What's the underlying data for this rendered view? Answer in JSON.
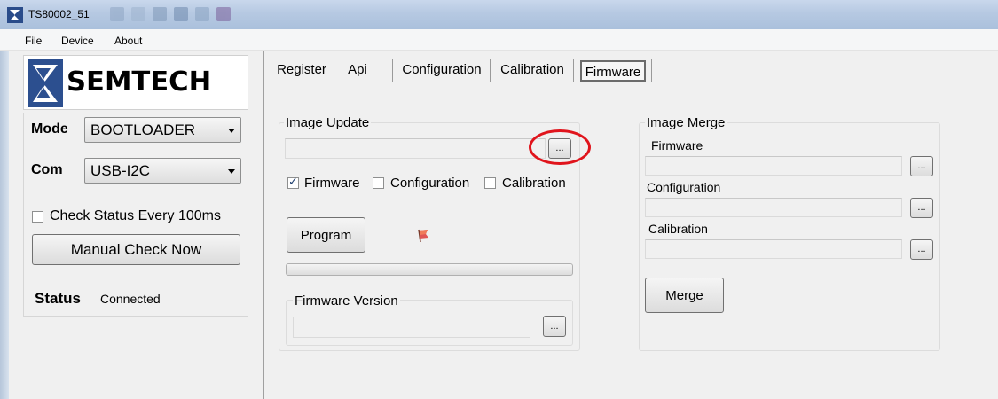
{
  "window": {
    "title": "TS80002_51"
  },
  "menu": [
    "File",
    "Device",
    "About"
  ],
  "logo": {
    "text": "SEMTECH"
  },
  "left_panel": {
    "mode_label": "Mode",
    "mode_value": "BOOTLOADER",
    "com_label": "Com",
    "com_value": "USB-I2C",
    "check_status_label": "Check Status Every 100ms",
    "check_status_checked": false,
    "manual_check_label": "Manual Check Now",
    "status_label": "Status",
    "status_value": "Connected"
  },
  "tabs": [
    "Register",
    "Api",
    "Configuration",
    "Calibration",
    "Firmware"
  ],
  "active_tab": "Firmware",
  "image_update": {
    "title": "Image Update",
    "path_value": "",
    "browse_label": "...",
    "checkboxes": [
      {
        "label": "Firmware",
        "checked": true
      },
      {
        "label": "Configuration",
        "checked": false
      },
      {
        "label": "Calibration",
        "checked": false
      }
    ],
    "program_label": "Program",
    "progress": 0,
    "firmware_version": {
      "title": "Firmware Version",
      "value": "",
      "browse_label": "..."
    }
  },
  "image_merge": {
    "title": "Image Merge",
    "firmware_label": "Firmware",
    "configuration_label": "Configuration",
    "calibration_label": "Calibration",
    "browse_label": "...",
    "merge_label": "Merge"
  },
  "colors": {
    "highlight_circle": "#e0141c",
    "title_bar": "#b6c9e2"
  }
}
